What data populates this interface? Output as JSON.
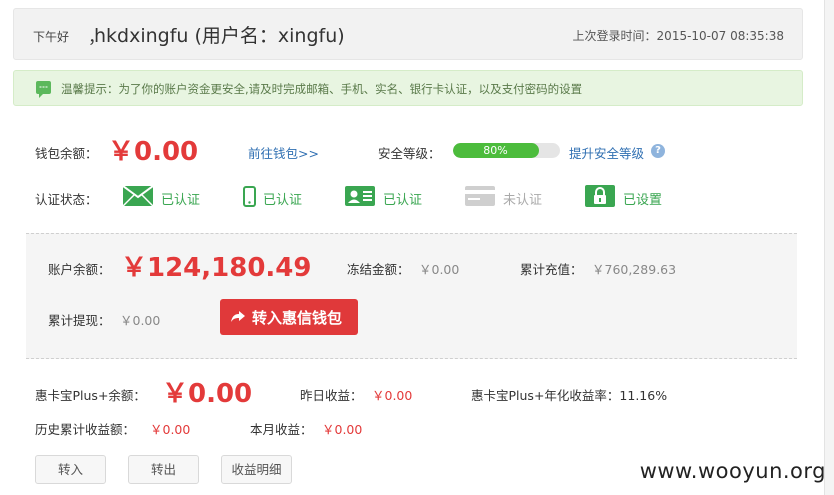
{
  "header": {
    "greeting": "下午好",
    "comma": "，",
    "username": "hkdxingfu (用户名：xingfu)",
    "last_login": "上次登录时间：2015-10-07 08:35:38"
  },
  "notice": {
    "icon": "chat-bubble-icon",
    "text": "温馨提示：为了你的账户资金更安全,请及时完成邮箱、手机、实名、银行卡认证，以及支付密码的设置"
  },
  "wallet": {
    "label": "钱包余额：",
    "amount": "￥0.00",
    "link": "前往钱包>>"
  },
  "security": {
    "label": "安全等级：",
    "level_text": "80%",
    "level_value": 0.8,
    "upgrade_link": "提升安全等级",
    "help_icon": "?"
  },
  "certification": {
    "label": "认证状态：",
    "items": [
      {
        "icon": "email-icon",
        "status": "已认证"
      },
      {
        "icon": "phone-icon",
        "status": "已认证"
      },
      {
        "icon": "id-card-icon",
        "status": "已认证"
      },
      {
        "icon": "bank-card-icon",
        "status": "未认证"
      },
      {
        "icon": "lock-icon",
        "status": "已设置"
      }
    ],
    "colors": {
      "verified": "#3aa651",
      "unverified": "#aaaaaa"
    }
  },
  "account": {
    "balance_label": "账户余额：",
    "balance": "￥124,180.49",
    "frozen_label": "冻结金额：",
    "frozen": "￥0.00",
    "recharge_label": "累计充值：",
    "recharge": "￥760,289.63",
    "withdraw_label": "累计提现：",
    "withdraw": "￥0.00",
    "transfer_button": "转入惠信钱包"
  },
  "plus": {
    "balance_label": "惠卡宝Plus+余额：",
    "balance": "￥0.00",
    "yesterday_label": "昨日收益：",
    "yesterday": "￥0.00",
    "rate_label": "惠卡宝Plus+年化收益率：11.16%",
    "history_label": "历史累计收益额：",
    "history": "￥0.00",
    "month_label": "本月收益：",
    "month": "￥0.00"
  },
  "buttons": {
    "deposit": "转入",
    "withdraw": "转出",
    "detail": "收益明细"
  },
  "watermark": "www.wooyun.org",
  "colors": {
    "accent_red": "#e33a3a",
    "link_blue": "#2f6fb2",
    "progress_green": "#4cbc3c"
  }
}
